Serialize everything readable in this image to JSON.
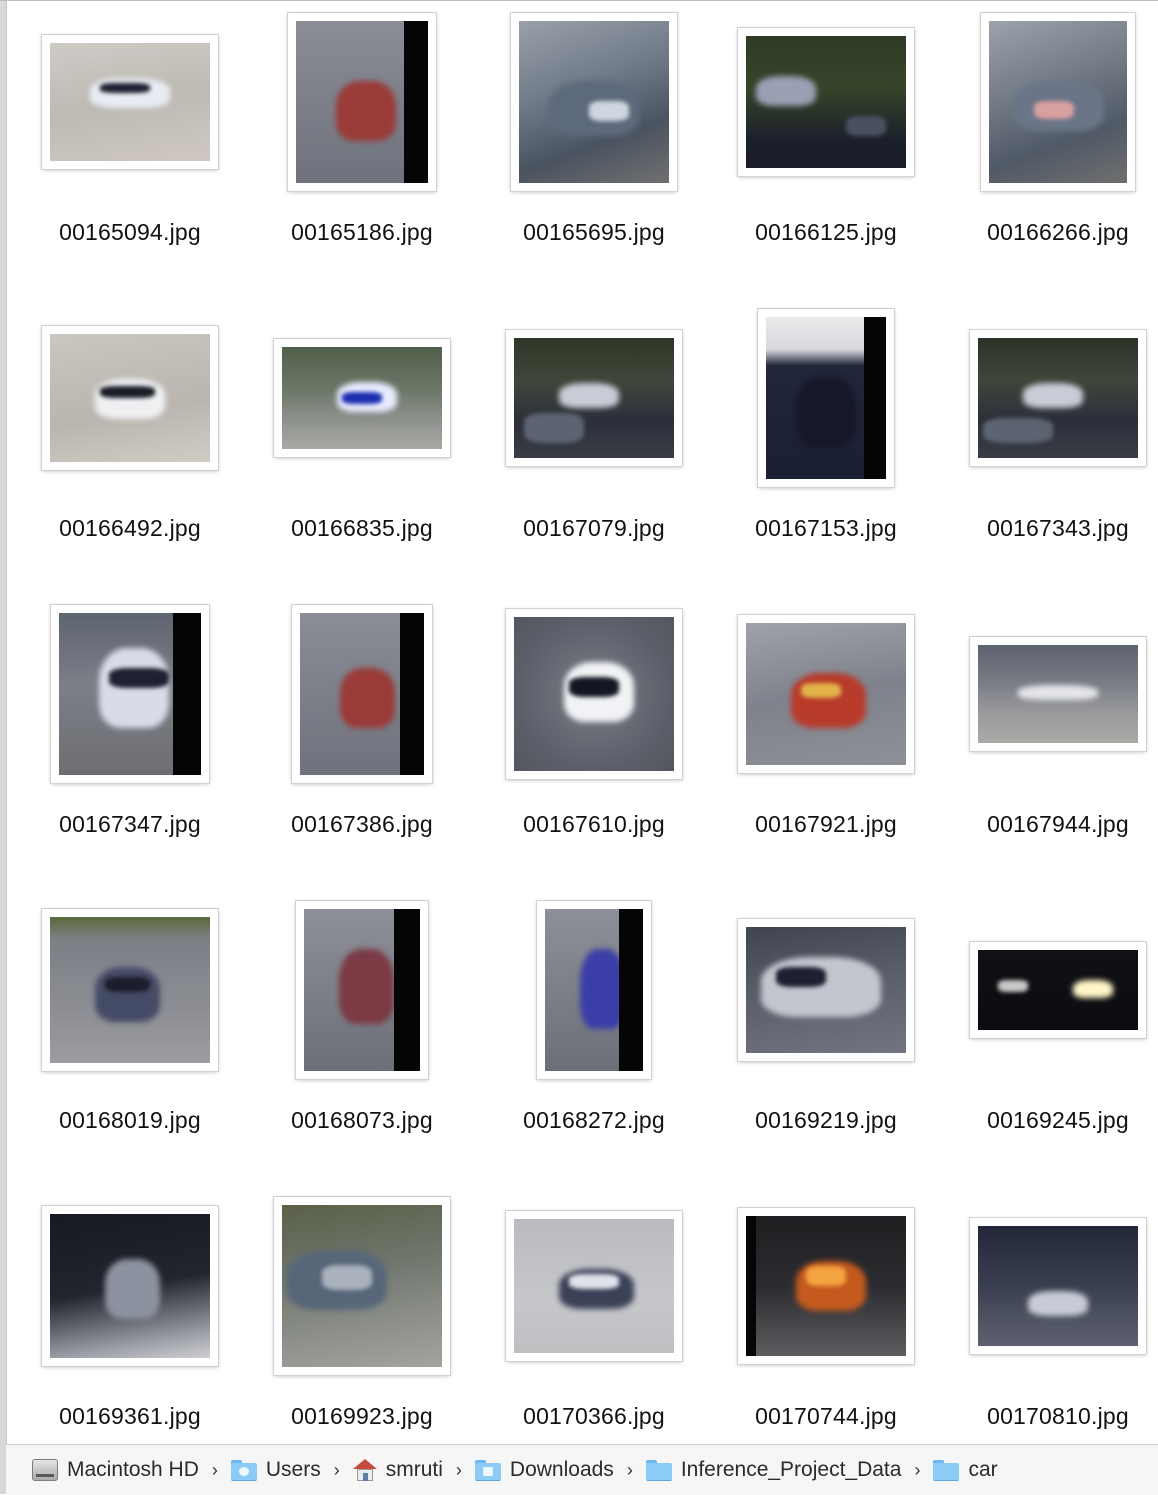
{
  "files": [
    {
      "name": "00165094.jpg",
      "w": 160,
      "h": 118,
      "bg": "linear-gradient(170deg,#cfcbc6 0%,#bdb9b3 50%,#cfc9c0 100%)",
      "car": [
        40,
        35,
        80,
        30,
        "#e8ecf2"
      ],
      "win": [
        50,
        40,
        50,
        10,
        "#1c1f2e"
      ]
    },
    {
      "name": "00165186.jpg",
      "w": 132,
      "h": 162,
      "bg": "linear-gradient(180deg,#8a8d96 0%,#6f727c 100%)",
      "car": [
        40,
        60,
        60,
        60,
        "#9a3b38"
      ],
      "band": 24
    },
    {
      "name": "00165695.jpg",
      "w": 150,
      "h": 162,
      "bg": "linear-gradient(160deg,#9aa0aa 0%,#6f7a88 40%,#4a5360 70%,#707070 100%)",
      "car": [
        30,
        60,
        90,
        55,
        "#5d6a7c"
      ],
      "win": [
        70,
        80,
        40,
        20,
        "#cfd6df"
      ]
    },
    {
      "name": "00166125.jpg",
      "w": 160,
      "h": 132,
      "bg": "linear-gradient(180deg,#2f3b26 0%,#38432a 40%,#1a1f2a 80%,#1b1e29 100%)",
      "car": [
        10,
        40,
        60,
        30,
        "#9aa0b4"
      ],
      "win": [
        100,
        80,
        40,
        20,
        "#4a5060"
      ]
    },
    {
      "name": "00166266.jpg",
      "w": 138,
      "h": 162,
      "bg": "linear-gradient(160deg,#9da2ab 0%,#727a86 40%,#505966 70%,#6f6f6f 100%)",
      "car": [
        25,
        60,
        90,
        50,
        "#6a7688"
      ],
      "win": [
        45,
        80,
        40,
        18,
        "#d9a0a0"
      ]
    },
    {
      "name": "00166492.jpg",
      "w": 160,
      "h": 128,
      "bg": "linear-gradient(170deg,#cac6c0 0%,#bab5ae 60%,#d1ccc3 100%)",
      "car": [
        45,
        45,
        70,
        40,
        "#eef0f2"
      ],
      "win": [
        50,
        52,
        55,
        12,
        "#1a1c26"
      ]
    },
    {
      "name": "00166835.jpg",
      "w": 160,
      "h": 102,
      "bg": "linear-gradient(180deg,#51604a 0%,#6b7666 40%,#8b8f8a 70%,#a9aaa6 100%)",
      "car": [
        55,
        35,
        60,
        30,
        "#e8ecff"
      ],
      "win": [
        60,
        45,
        40,
        12,
        "#1b2fb0"
      ]
    },
    {
      "name": "00167079.jpg",
      "w": 160,
      "h": 120,
      "bg": "linear-gradient(180deg,#2c3526 0%,#40473a 35%,#2a2f3a 70%,#3a3d45 100%)",
      "car": [
        45,
        45,
        60,
        25,
        "#c7ccd6"
      ],
      "win": [
        10,
        75,
        60,
        30,
        "#5c6472"
      ]
    },
    {
      "name": "00167153.jpg",
      "w": 120,
      "h": 162,
      "bg": "linear-gradient(180deg,#e9e9ea 0%,#d7d8de 20%,#22263a 30%,#1b1f33 100%)",
      "car": [
        30,
        60,
        60,
        70,
        "#151829"
      ],
      "band": 22
    },
    {
      "name": "00167343.jpg",
      "w": 160,
      "h": 120,
      "bg": "linear-gradient(180deg,#2a3326 0%,#3f463a 35%,#2a2f3a 70%,#3a3d45 100%)",
      "car": [
        45,
        45,
        60,
        25,
        "#c7ccd6"
      ],
      "win": [
        5,
        80,
        70,
        25,
        "#5c6472"
      ]
    },
    {
      "name": "00167347.jpg",
      "w": 142,
      "h": 162,
      "bg": "linear-gradient(180deg,#5e6470 0%,#7c7f88 45%,#6d6e72 100%)",
      "car": [
        40,
        35,
        70,
        80,
        "#d8dbe8"
      ],
      "win": [
        50,
        55,
        60,
        20,
        "#1d2130"
      ],
      "band": 28
    },
    {
      "name": "00167386.jpg",
      "w": 124,
      "h": 162,
      "bg": "linear-gradient(180deg,#8a8d96 0%,#6f727c 100%)",
      "car": [
        40,
        55,
        55,
        60,
        "#9a3b38"
      ],
      "band": 24
    },
    {
      "name": "00167610.jpg",
      "w": 160,
      "h": 154,
      "bg": "radial-gradient(circle at 50% 50%,#7a7c86 0%,#5b5d68 70%,#55575f 100%)",
      "car": [
        50,
        45,
        70,
        60,
        "#f0f2f5"
      ],
      "win": [
        55,
        60,
        50,
        20,
        "#141722"
      ]
    },
    {
      "name": "00167921.jpg",
      "w": 160,
      "h": 142,
      "bg": "linear-gradient(170deg,#9fa2aa 0%,#7f828c 50%,#8e9097 100%)",
      "car": [
        45,
        50,
        75,
        55,
        "#b83a2b"
      ],
      "win": [
        55,
        60,
        40,
        15,
        "#e2b34a"
      ]
    },
    {
      "name": "00167944.jpg",
      "w": 160,
      "h": 98,
      "bg": "linear-gradient(180deg,#5d6270 0%,#7a7d85 40%,#9a9b9d 70%,#aaa9a6 100%)",
      "car": [
        40,
        40,
        80,
        15,
        "#e3e5ea"
      ]
    },
    {
      "name": "00168019.jpg",
      "w": 160,
      "h": 146,
      "bg": "linear-gradient(180deg,#5a6a3a 0%,#7d7f86 15%,#8b8d93 60%,#9b9ca0 100%)",
      "car": [
        45,
        50,
        65,
        55,
        "#444b66"
      ],
      "win": [
        55,
        60,
        45,
        15,
        "#1a1d2c"
      ]
    },
    {
      "name": "00168073.jpg",
      "w": 116,
      "h": 162,
      "bg": "linear-gradient(180deg,#8e9099 0%,#6c6f78 100%)",
      "car": [
        35,
        40,
        55,
        75,
        "#7b3a44"
      ],
      "band": 26
    },
    {
      "name": "00168272.jpg",
      "w": 98,
      "h": 162,
      "bg": "linear-gradient(180deg,#8e9099 0%,#6c6f78 100%)",
      "car": [
        35,
        40,
        45,
        80,
        "#3b3ea8"
      ],
      "band": 24
    },
    {
      "name": "00169219.jpg",
      "w": 160,
      "h": 126,
      "bg": "linear-gradient(170deg,#40444e 0%,#5c606a 50%,#727580 100%)",
      "car": [
        15,
        30,
        120,
        60,
        "#c2c6cf"
      ],
      "win": [
        30,
        40,
        50,
        20,
        "#1d2030"
      ]
    },
    {
      "name": "00169245.jpg",
      "w": 160,
      "h": 80,
      "bg": "linear-gradient(180deg,#101114 0%,#0b0c10 100%)",
      "car": [
        95,
        30,
        40,
        18,
        "#fff6c8"
      ],
      "win": [
        20,
        30,
        30,
        12,
        "#c8c8c8"
      ]
    },
    {
      "name": "00169361.jpg",
      "w": 160,
      "h": 144,
      "bg": "linear-gradient(170deg,#161a22 0%,#20252e 50%,#9da0a8 85%,#cfcfd2 100%)",
      "car": [
        55,
        45,
        55,
        60,
        "#8d92a0"
      ]
    },
    {
      "name": "00169923.jpg",
      "w": 160,
      "h": 162,
      "bg": "linear-gradient(170deg,#5a6048 0%,#6f766c 40%,#8b8e88 70%,#a3a39e 100%)",
      "car": [
        5,
        45,
        100,
        60,
        "#58667a"
      ],
      "win": [
        40,
        60,
        50,
        25,
        "#a9b2bd"
      ]
    },
    {
      "name": "00170366.jpg",
      "w": 160,
      "h": 134,
      "bg": "linear-gradient(180deg,#b9bbc0 0%,#c6c7cb 60%,#bfbfc2 100%)",
      "car": [
        45,
        50,
        75,
        40,
        "#3b4258"
      ],
      "win": [
        55,
        55,
        50,
        15,
        "#dfe2ea"
      ]
    },
    {
      "name": "00170744.jpg",
      "w": 160,
      "h": 140,
      "bg": "linear-gradient(180deg,#1f1f22 0%,#2c2c30 50%,#5d5d60 100%)",
      "car": [
        50,
        45,
        70,
        50,
        "#c45a1e"
      ],
      "win": [
        60,
        50,
        40,
        20,
        "#f4a341"
      ],
      "bandLeft": 10
    },
    {
      "name": "00170810.jpg",
      "w": 160,
      "h": 120,
      "bg": "linear-gradient(180deg,#23273a 0%,#3a3f50 50%,#5e6270 100%)",
      "car": [
        50,
        65,
        60,
        25,
        "#c7ccd6"
      ]
    }
  ],
  "path": [
    {
      "label": "Macintosh HD",
      "icon": "hard-drive-icon"
    },
    {
      "label": "Users",
      "icon": "users-folder-icon"
    },
    {
      "label": "smruti",
      "icon": "home-icon"
    },
    {
      "label": "Downloads",
      "icon": "downloads-folder-icon"
    },
    {
      "label": "Inference_Project_Data",
      "icon": "folder-icon"
    },
    {
      "label": "car",
      "icon": "folder-icon"
    }
  ],
  "separator": "›"
}
